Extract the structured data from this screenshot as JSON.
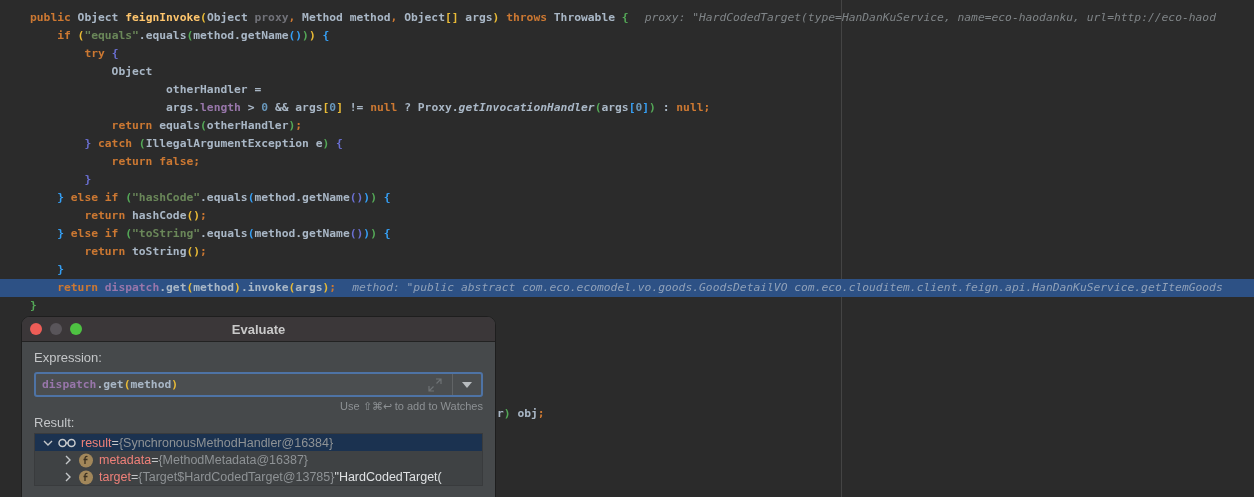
{
  "code_lines": [
    {
      "highlighted": false,
      "tokens": [
        {
          "text": "public",
          "color": "#cc7832"
        },
        {
          "text": " Object ",
          "color": "#a9b7c6"
        },
        {
          "text": "feignInvoke",
          "color": "#ffc66d"
        },
        {
          "text": "(",
          "color": "#e8ba36"
        },
        {
          "text": "Object ",
          "color": "#a9b7c6"
        },
        {
          "text": "proxy",
          "color": "#72737a"
        },
        {
          "text": ", ",
          "color": "#cc7832"
        },
        {
          "text": "Method method",
          "color": "#a9b7c6"
        },
        {
          "text": ", ",
          "color": "#cc7832"
        },
        {
          "text": "Object",
          "color": "#a9b7c6"
        },
        {
          "text": "[]",
          "color": "#e8ba36"
        },
        {
          "text": " args",
          "color": "#a9b7c6"
        },
        {
          "text": ")",
          "color": "#e8ba36"
        },
        {
          "text": " throws ",
          "color": "#cc7832"
        },
        {
          "text": "Throwable ",
          "color": "#a9b7c6"
        },
        {
          "text": "{",
          "color": "#54a857"
        }
      ],
      "hint": "proxy: \"HardCodedTarget(type=HanDanKuService, name=eco-haodanku, url=http://eco-haod"
    },
    {
      "highlighted": false,
      "tokens": [
        {
          "text": "    if",
          "color": "#cc7832"
        },
        {
          "text": " (",
          "color": "#e8ba36"
        },
        {
          "text": "\"equals\"",
          "color": "#6a8759"
        },
        {
          "text": ".equals",
          "color": "#a9b7c6"
        },
        {
          "text": "(",
          "color": "#54a857"
        },
        {
          "text": "method.getName",
          "color": "#a9b7c6"
        },
        {
          "text": "()",
          "color": "#359ff4"
        },
        {
          "text": ")",
          "color": "#54a857"
        },
        {
          "text": ")",
          "color": "#e8ba36"
        },
        {
          "text": " {",
          "color": "#359ff4"
        }
      ]
    },
    {
      "highlighted": false,
      "tokens": [
        {
          "text": "        try",
          "color": "#cc7832"
        },
        {
          "text": " {",
          "color": "#6a6fd1"
        }
      ]
    },
    {
      "highlighted": false,
      "tokens": [
        {
          "text": "            Object",
          "color": "#a9b7c6"
        }
      ]
    },
    {
      "highlighted": false,
      "tokens": [
        {
          "text": "                    otherHandler =",
          "color": "#a9b7c6"
        }
      ]
    },
    {
      "highlighted": false,
      "tokens": [
        {
          "text": "                    args.",
          "color": "#a9b7c6"
        },
        {
          "text": "length",
          "color": "#9876aa"
        },
        {
          "text": " > ",
          "color": "#a9b7c6"
        },
        {
          "text": "0",
          "color": "#6897bb"
        },
        {
          "text": " && args",
          "color": "#a9b7c6"
        },
        {
          "text": "[",
          "color": "#e8ba36"
        },
        {
          "text": "0",
          "color": "#6897bb"
        },
        {
          "text": "]",
          "color": "#e8ba36"
        },
        {
          "text": " != ",
          "color": "#a9b7c6"
        },
        {
          "text": "null",
          "color": "#cc7832"
        },
        {
          "text": " ? Proxy.",
          "color": "#a9b7c6"
        },
        {
          "text": "getInvocationHandler",
          "color": "#a9b7c6",
          "italic": true
        },
        {
          "text": "(",
          "color": "#54a857"
        },
        {
          "text": "args",
          "color": "#a9b7c6"
        },
        {
          "text": "[",
          "color": "#359ff4"
        },
        {
          "text": "0",
          "color": "#6897bb"
        },
        {
          "text": "]",
          "color": "#359ff4"
        },
        {
          "text": ")",
          "color": "#54a857"
        },
        {
          "text": " : ",
          "color": "#a9b7c6"
        },
        {
          "text": "null;",
          "color": "#cc7832"
        }
      ]
    },
    {
      "highlighted": false,
      "tokens": [
        {
          "text": "            return",
          "color": "#cc7832"
        },
        {
          "text": " equals",
          "color": "#a9b7c6"
        },
        {
          "text": "(",
          "color": "#54a857"
        },
        {
          "text": "otherHandler",
          "color": "#a9b7c6"
        },
        {
          "text": ")",
          "color": "#54a857"
        },
        {
          "text": ";",
          "color": "#cc7832"
        }
      ]
    },
    {
      "highlighted": false,
      "tokens": [
        {
          "text": "        }",
          "color": "#6a6fd1"
        },
        {
          "text": " catch ",
          "color": "#cc7832"
        },
        {
          "text": "(",
          "color": "#54a857"
        },
        {
          "text": "IllegalArgumentException e",
          "color": "#a9b7c6"
        },
        {
          "text": ")",
          "color": "#54a857"
        },
        {
          "text": " {",
          "color": "#6a6fd1"
        }
      ]
    },
    {
      "highlighted": false,
      "tokens": [
        {
          "text": "            return false;",
          "color": "#cc7832"
        }
      ]
    },
    {
      "highlighted": false,
      "tokens": [
        {
          "text": "        }",
          "color": "#6a6fd1"
        }
      ]
    },
    {
      "highlighted": false,
      "tokens": [
        {
          "text": "    }",
          "color": "#359ff4"
        },
        {
          "text": " else if ",
          "color": "#cc7832"
        },
        {
          "text": "(",
          "color": "#54a857"
        },
        {
          "text": "\"hashCode\"",
          "color": "#6a8759"
        },
        {
          "text": ".equals",
          "color": "#a9b7c6"
        },
        {
          "text": "(",
          "color": "#359ff4"
        },
        {
          "text": "method.getName",
          "color": "#a9b7c6"
        },
        {
          "text": "()",
          "color": "#6a6fd1"
        },
        {
          "text": ")",
          "color": "#359ff4"
        },
        {
          "text": ")",
          "color": "#54a857"
        },
        {
          "text": " {",
          "color": "#359ff4"
        }
      ]
    },
    {
      "highlighted": false,
      "tokens": [
        {
          "text": "        return",
          "color": "#cc7832"
        },
        {
          "text": " hashCode",
          "color": "#a9b7c6"
        },
        {
          "text": "()",
          "color": "#e8ba36"
        },
        {
          "text": ";",
          "color": "#cc7832"
        }
      ]
    },
    {
      "highlighted": false,
      "tokens": [
        {
          "text": "    }",
          "color": "#359ff4"
        },
        {
          "text": " else if ",
          "color": "#cc7832"
        },
        {
          "text": "(",
          "color": "#54a857"
        },
        {
          "text": "\"toString\"",
          "color": "#6a8759"
        },
        {
          "text": ".equals",
          "color": "#a9b7c6"
        },
        {
          "text": "(",
          "color": "#359ff4"
        },
        {
          "text": "method.getName",
          "color": "#a9b7c6"
        },
        {
          "text": "()",
          "color": "#6a6fd1"
        },
        {
          "text": ")",
          "color": "#359ff4"
        },
        {
          "text": ")",
          "color": "#54a857"
        },
        {
          "text": " {",
          "color": "#359ff4"
        }
      ]
    },
    {
      "highlighted": false,
      "tokens": [
        {
          "text": "        return",
          "color": "#cc7832"
        },
        {
          "text": " toString",
          "color": "#a9b7c6"
        },
        {
          "text": "()",
          "color": "#e8ba36"
        },
        {
          "text": ";",
          "color": "#cc7832"
        }
      ]
    },
    {
      "highlighted": false,
      "tokens": [
        {
          "text": "    }",
          "color": "#359ff4"
        }
      ]
    },
    {
      "highlighted": true,
      "tokens": [
        {
          "text": "    return",
          "color": "#cc7832"
        },
        {
          "text": " dispatch",
          "color": "#9876aa"
        },
        {
          "text": ".get",
          "color": "#a9b7c6"
        },
        {
          "text": "(",
          "color": "#e8ba36"
        },
        {
          "text": "method",
          "color": "#a9b7c6"
        },
        {
          "text": ")",
          "color": "#e8ba36"
        },
        {
          "text": ".invoke",
          "color": "#a9b7c6"
        },
        {
          "text": "(",
          "color": "#e8ba36"
        },
        {
          "text": "args",
          "color": "#a9b7c6"
        },
        {
          "text": ")",
          "color": "#e8ba36"
        },
        {
          "text": ";",
          "color": "#cc7832"
        }
      ],
      "hint": "method: \"public abstract com.eco.ecomodel.vo.goods.GoodsDetailVO com.eco.clouditem.client.feign.api.HanDanKuService.getItemGoods"
    },
    {
      "highlighted": false,
      "tokens": [
        {
          "text": "}",
          "color": "#54a857"
        }
      ]
    }
  ],
  "hidden_fragment": [
    {
      "text": "r",
      "color": "#a9b7c6"
    },
    {
      "text": ")",
      "color": "#54a857"
    },
    {
      "text": " obj",
      "color": "#a9b7c6"
    },
    {
      "text": ";",
      "color": "#cc7832"
    }
  ],
  "dialog": {
    "title": "Evaluate",
    "expression_label": "Expression:",
    "expression": [
      {
        "text": "dispatch",
        "color": "#9876aa"
      },
      {
        "text": ".get",
        "color": "#a9b7c6"
      },
      {
        "text": "(",
        "color": "#e8ba36"
      },
      {
        "text": "method",
        "color": "#a9b7c6"
      },
      {
        "text": ")",
        "color": "#e8ba36"
      }
    ],
    "watch_hint": "Use ⇧⌘↩ to add to Watches",
    "result_label": "Result:",
    "tree": [
      {
        "kind": "result",
        "expanded": true,
        "selected": true,
        "name": "result",
        "operator": "=",
        "value": "{SynchronousMethodHandler@16384}",
        "children": [
          {
            "kind": "field",
            "expanded": false,
            "selected": false,
            "name": "metadata",
            "operator": "=",
            "value": "{MethodMetadata@16387}"
          },
          {
            "kind": "field",
            "expanded": false,
            "selected": false,
            "name": "target",
            "operator": "=",
            "value": "{Target$HardCodedTarget@13785}",
            "string": "\"HardCodedTarget("
          }
        ]
      }
    ]
  }
}
